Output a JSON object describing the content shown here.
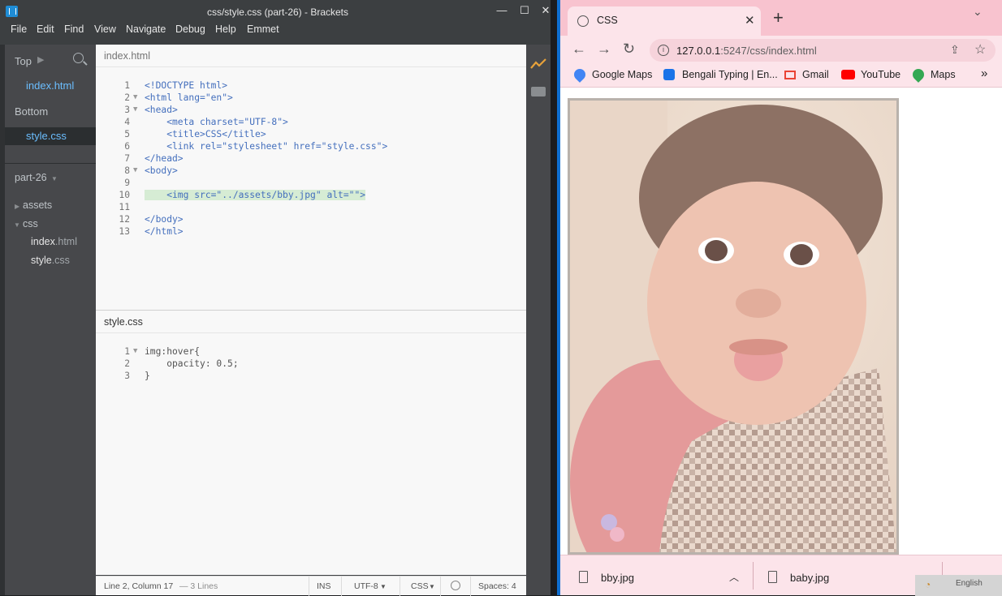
{
  "brackets": {
    "window_title": "css/style.css (part-26) - Brackets",
    "menu": [
      "File",
      "Edit",
      "Find",
      "View",
      "Navigate",
      "Debug",
      "Help",
      "Emmet"
    ],
    "sidebar": {
      "top_label": "Top",
      "top_file": "index.html",
      "bottom_label": "Bottom",
      "bottom_file": "style.css",
      "project_name": "part-26",
      "tree": {
        "folder_assets": "assets",
        "folder_css": "css",
        "file_index": "index",
        "file_index_ext": ".html",
        "file_style": "style",
        "file_style_ext": ".css"
      }
    },
    "top_pane": {
      "filename": "index.html",
      "line_numbers": [
        "1",
        "2",
        "3",
        "4",
        "5",
        "6",
        "7",
        "8",
        "9",
        "10",
        "11",
        "12",
        "13"
      ],
      "lines": [
        "<!DOCTYPE html>",
        "<html lang=\"en\">",
        "<head>",
        "    <meta charset=\"UTF-8\">",
        "    <title>CSS</title>",
        "    <link rel=\"stylesheet\" href=\"style.css\">",
        "</head>",
        "<body>",
        "",
        "    <img src=\"../assets/bby.jpg\" alt=\"\">",
        "",
        "</body>",
        "</html>"
      ]
    },
    "bottom_pane": {
      "filename": "style.css",
      "line_numbers": [
        "1",
        "2",
        "3"
      ],
      "lines": [
        "img:hover{",
        "    opacity: 0.5;",
        "}"
      ]
    },
    "status": {
      "position": "Line 2, Column 17",
      "lines_info": "— 3 Lines",
      "mode": "INS",
      "encoding": "UTF-8",
      "language": "CSS",
      "spaces": "Spaces:  4"
    }
  },
  "chrome": {
    "tab_title": "CSS",
    "url_host": "127.0.0.1",
    "url_rest": ":5247/css/index.html",
    "bookmarks": [
      "Google Maps",
      "Bengali Typing | En...",
      "Gmail",
      "YouTube",
      "Maps"
    ],
    "downloads": [
      "bby.jpg",
      "baby.jpg"
    ],
    "tray_language": "English"
  },
  "colors": {
    "brackets_dark": "#3c3f41",
    "editor_bg": "#f8f8f8",
    "chrome_tabstrip": "#f8c3cf",
    "chrome_toolbar": "#fce4ea",
    "tag": "#446fbd",
    "attr": "#6d8600",
    "string": "#e88501"
  }
}
